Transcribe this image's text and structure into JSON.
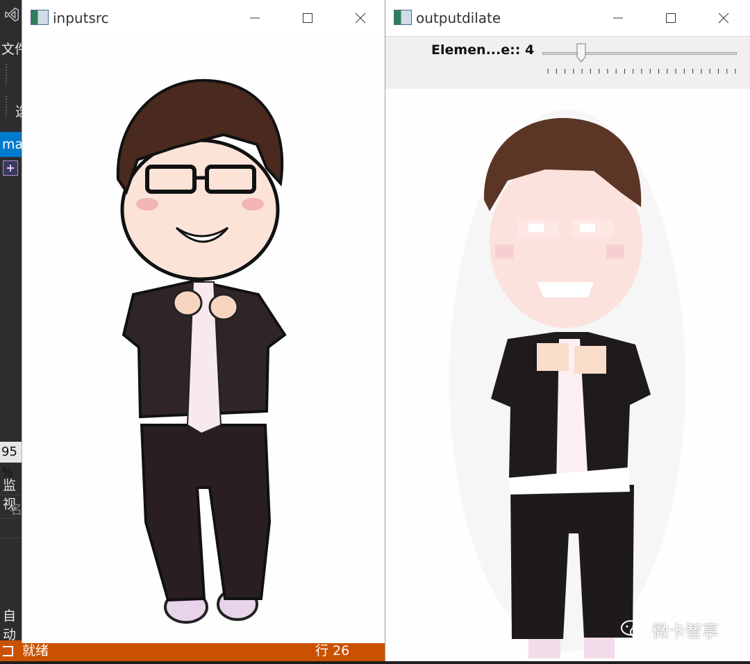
{
  "ide": {
    "menu_partial": "文件",
    "tool_partial": "选",
    "tab_partial": "ma",
    "zoom_partial": "95 %",
    "watch_partial": "监视",
    "watch_column_partial": "名",
    "autos_partial": "自动"
  },
  "status_bar": {
    "ready": "就绪",
    "line": "行 26",
    "color": "#ca5100"
  },
  "windows": [
    {
      "id": "left",
      "title": "inputsrc"
    },
    {
      "id": "right",
      "title": "outputdilate",
      "trackbar": {
        "label": "Elemen...e:: 4",
        "value": 4,
        "fraction": 0.2,
        "tick_count": 23
      }
    }
  ],
  "watermark": {
    "text": "微卡智享"
  }
}
